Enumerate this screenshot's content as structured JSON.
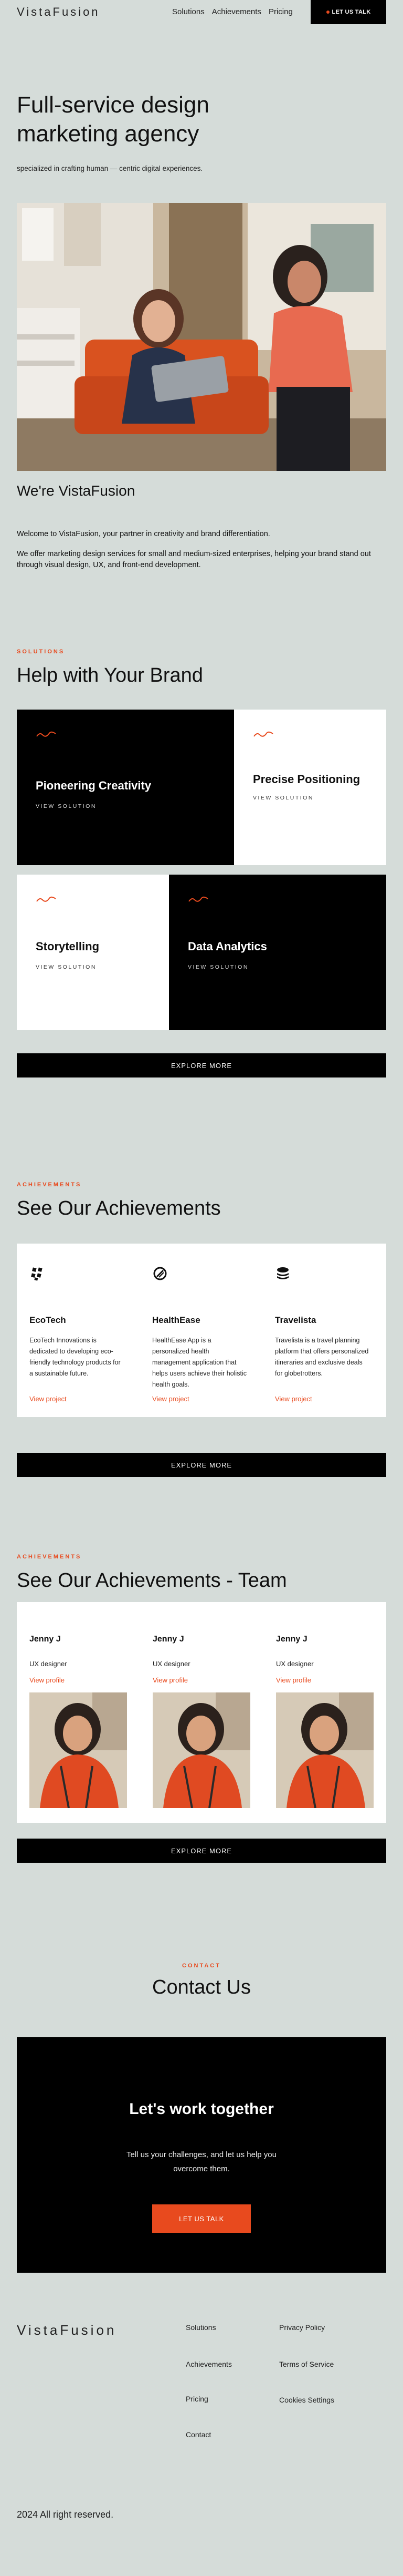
{
  "header": {
    "logo": "VistaFusion",
    "nav": [
      "Solutions",
      "Achievements",
      "Pricing"
    ],
    "cta": "LET US TALK"
  },
  "hero": {
    "title_line1": "Full-service design",
    "title_line2": "marketing agency",
    "subtitle": "specialized in crafting human — centric digital experiences."
  },
  "about": {
    "title": "We're VistaFusion",
    "p1": "Welcome to VistaFusion, your partner in creativity and brand differentiation.",
    "p2": "We offer marketing design services for small and medium-sized enterprises, helping your brand stand out through visual design, UX, and front-end development."
  },
  "services": {
    "eyebrow": "SOLUTIONS",
    "title": "Help with Your Brand",
    "items": [
      {
        "title": "Pioneering Creativity",
        "link": "VIEW SOLUTION"
      },
      {
        "title": "Precise Positioning",
        "link": "VIEW SOLUTION"
      },
      {
        "title": "Storytelling",
        "link": "VIEW SOLUTION"
      },
      {
        "title": "Data Analytics",
        "link": "VIEW SOLUTION"
      }
    ],
    "explore": "EXPLORE MORE"
  },
  "achievements": {
    "eyebrow": "ACHIEVEMENTS",
    "title": "See Our Achievements",
    "items": [
      {
        "name": "EcoTech",
        "desc": "EcoTech Innovations is dedicated to developing eco-friendly technology products for a sustainable future.",
        "link": "View project",
        "icon": "grid-dots-icon"
      },
      {
        "name": "HealthEase",
        "desc": "HealthEase App is a personalized health management application that helps users achieve their holistic health goals.",
        "link": "View project",
        "icon": "circle-slash-icon"
      },
      {
        "name": "Travelista",
        "desc": "Travelista is a travel planning platform that offers personalized itineraries and exclusive deals for globetrotters.",
        "link": "View project",
        "icon": "stack-layers-icon"
      }
    ],
    "explore": "EXPLORE MORE"
  },
  "team": {
    "eyebrow": "ACHIEVEMENTS",
    "title": "See Our Achievements - Team",
    "members": [
      {
        "name": "Jenny J",
        "role": "UX designer",
        "link": "View profile"
      },
      {
        "name": "Jenny J",
        "role": "UX designer",
        "link": "View profile"
      },
      {
        "name": "Jenny J",
        "role": "UX designer",
        "link": "View profile"
      }
    ],
    "explore": "EXPLORE MORE"
  },
  "contact": {
    "eyebrow": "CONTACT",
    "title": "Contact Us",
    "cta_title": "Let's work together",
    "cta_sub": "Tell us your challenges, and let us help you overcome them.",
    "cta_button": "LET US TALK"
  },
  "footer": {
    "logo": "VistaFusion",
    "col1": [
      "Solutions",
      "Achievements",
      "Pricing",
      "Contact"
    ],
    "col2": [
      "Privacy Policy",
      "Terms of Service",
      "Cookies Settings"
    ],
    "copyright": "2024 All right reserved."
  },
  "colors": {
    "background": "#d5dcd9",
    "accent": "#e84a1e",
    "dark": "#000000"
  }
}
